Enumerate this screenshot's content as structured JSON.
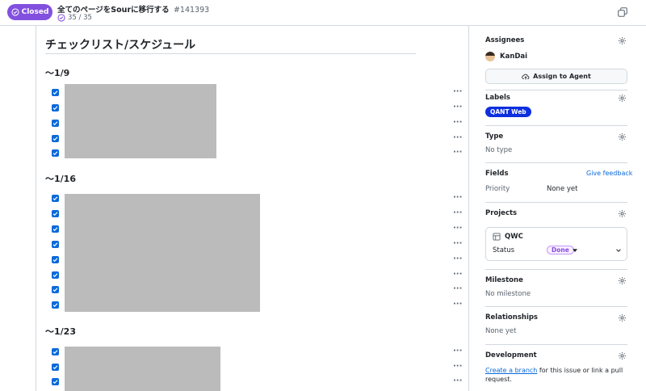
{
  "header": {
    "state_label": "Closed",
    "title": "全てのページをSourに移行する",
    "issue_number": "#141393",
    "progress": "35 / 35",
    "colors": {
      "closed": "#8250df"
    }
  },
  "main": {
    "heading": "チェックリスト/スケジュール",
    "sections": [
      {
        "heading": "〜1/9",
        "checked_count": 5
      },
      {
        "heading": "〜1/16",
        "checked_count": 8
      },
      {
        "heading": "〜1/23",
        "checked_count": 3
      }
    ],
    "menu_glyph": "···"
  },
  "sidebar": {
    "assignees": {
      "title": "Assignees",
      "user": "KanDai",
      "agent_button": "Assign to Agent"
    },
    "labels": {
      "title": "Labels",
      "items": [
        "QANT Web"
      ],
      "label_color": "#0d2fe0"
    },
    "type": {
      "title": "Type",
      "value": "No type"
    },
    "fields": {
      "title": "Fields",
      "feedback_link": "Give feedback",
      "priority_label": "Priority",
      "priority_value": "None yet"
    },
    "projects": {
      "title": "Projects",
      "project_name": "QWC",
      "status_label": "Status",
      "status_value": "Done"
    },
    "milestone": {
      "title": "Milestone",
      "value": "No milestone"
    },
    "relationships": {
      "title": "Relationships",
      "value": "None yet"
    },
    "development": {
      "title": "Development",
      "link_text": "Create a branch",
      "rest_text": " for this issue or link a pull request."
    }
  }
}
